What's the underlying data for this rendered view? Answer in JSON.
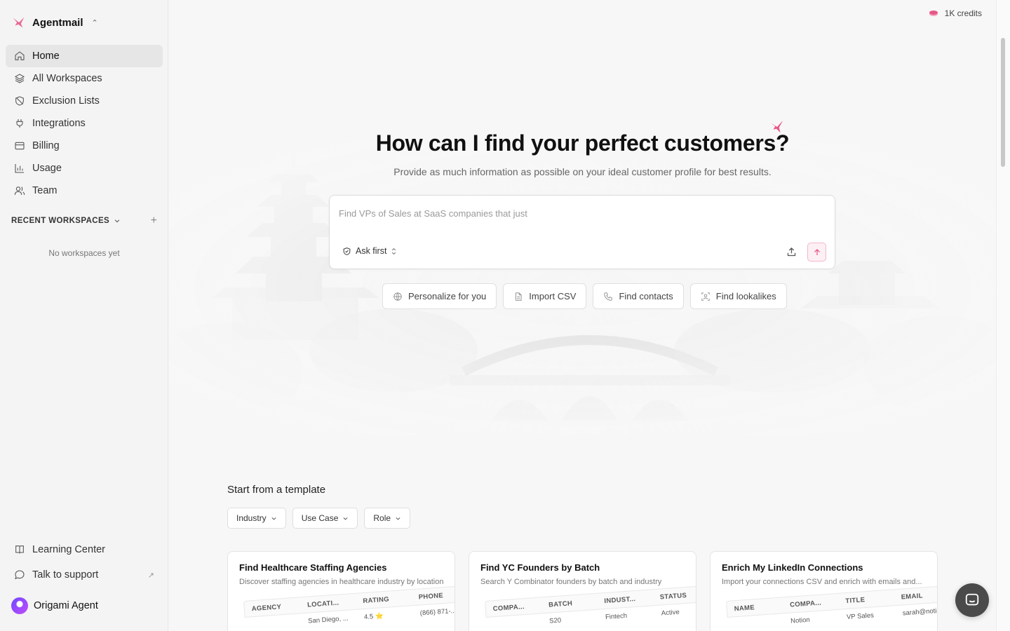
{
  "sidebar": {
    "brand": {
      "label": "Agentmail",
      "icon": "bird-logo-icon"
    },
    "nav": [
      {
        "label": "Home",
        "icon": "home-icon",
        "active": true
      },
      {
        "label": "All Workspaces",
        "icon": "layers-icon"
      },
      {
        "label": "Exclusion Lists",
        "icon": "shield-off-icon"
      },
      {
        "label": "Integrations",
        "icon": "plug-icon"
      },
      {
        "label": "Billing",
        "icon": "credit-card-icon"
      },
      {
        "label": "Usage",
        "icon": "bar-chart-icon"
      },
      {
        "label": "Team",
        "icon": "users-icon"
      }
    ],
    "recent_title": "RECENT WORKSPACES",
    "empty_text": "No workspaces yet",
    "bottom": [
      {
        "label": "Learning Center",
        "icon": "book-icon"
      },
      {
        "label": "Talk to support",
        "icon": "message-icon",
        "external": "↗"
      }
    ],
    "user": {
      "name": "Origami Agent"
    }
  },
  "header": {
    "credits": "1K credits"
  },
  "hero": {
    "title": "How can I find your perfect customers?",
    "subtitle": "Provide as much information as possible on your ideal customer profile for best results."
  },
  "prompt": {
    "placeholder": "Find VPs of Sales at SaaS companies that just",
    "mode_label": "Ask first"
  },
  "actions": [
    {
      "label": "Personalize for you",
      "icon": "globe-icon"
    },
    {
      "label": "Import CSV",
      "icon": "file-icon"
    },
    {
      "label": "Find contacts",
      "icon": "phone-icon"
    },
    {
      "label": "Find lookalikes",
      "icon": "scan-face-icon"
    }
  ],
  "templates": {
    "title": "Start from a template",
    "filters": [
      "Industry",
      "Use Case",
      "Role"
    ],
    "cards": [
      {
        "title": "Find Healthcare Staffing Agencies",
        "desc": "Discover staffing agencies in healthcare industry by location",
        "columns": [
          "AGENCY",
          "LOCATI...",
          "RATING",
          "PHONE"
        ],
        "row": [
          "",
          "San Diego, ...",
          "4.5 ⭐",
          "(866) 871-..."
        ]
      },
      {
        "title": "Find YC Founders by Batch",
        "desc": "Search Y Combinator founders by batch and industry",
        "columns": [
          "COMPA...",
          "BATCH",
          "INDUST...",
          "STATUS"
        ],
        "row": [
          "",
          "S20",
          "Fintech",
          "Active"
        ]
      },
      {
        "title": "Enrich My LinkedIn Connections",
        "desc": "Import your connections CSV and enrich with emails and...",
        "columns": [
          "NAME",
          "COMPA...",
          "TITLE",
          "EMAIL"
        ],
        "row": [
          "",
          "Notion",
          "VP Sales",
          "sarah@noti..."
        ]
      }
    ]
  },
  "colors": {
    "accent_pink": "#e8578a",
    "sidebar_bg": "#f4f4f4"
  }
}
